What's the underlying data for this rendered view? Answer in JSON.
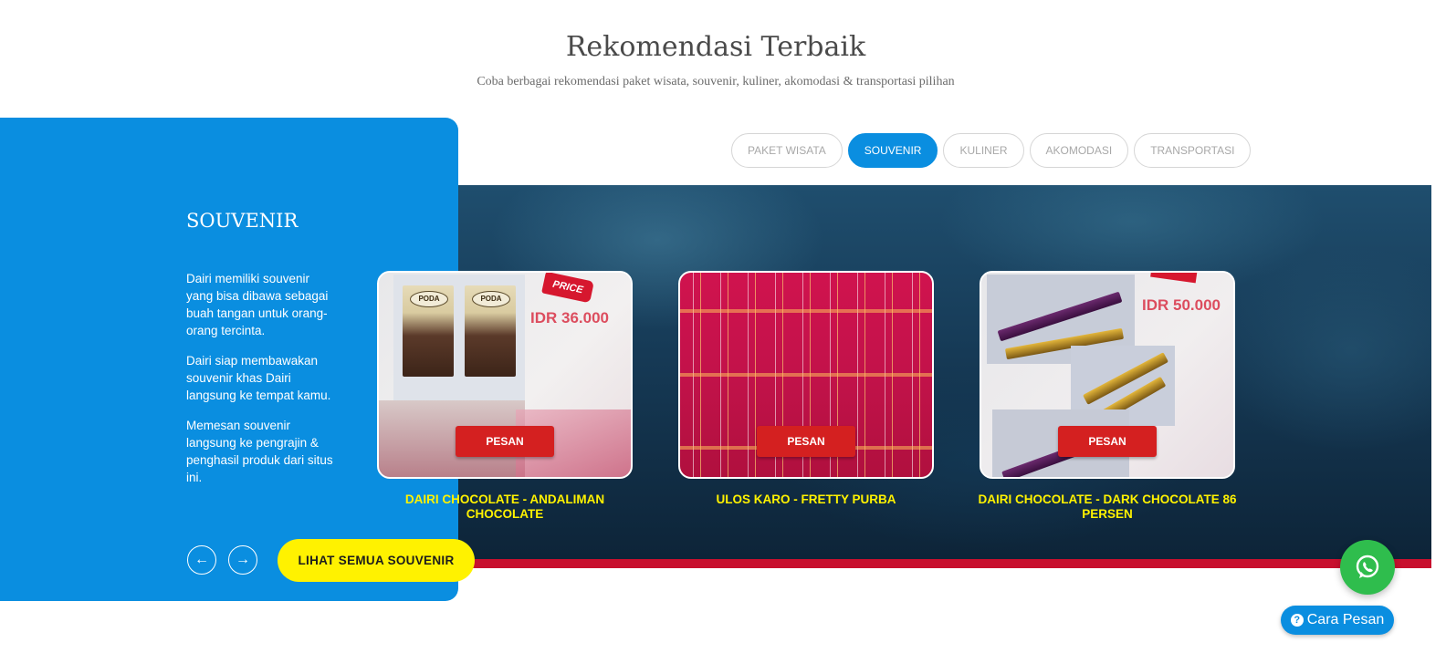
{
  "header": {
    "title": "Rekomendasi Terbaik",
    "subtitle": "Coba berbagai rekomendasi paket wisata, souvenir, kuliner, akomodasi & transportasi pilihan"
  },
  "tabs": [
    {
      "label": "PAKET WISATA",
      "active": false
    },
    {
      "label": "SOUVENIR",
      "active": true
    },
    {
      "label": "KULINER",
      "active": false
    },
    {
      "label": "AKOMODASI",
      "active": false
    },
    {
      "label": "TRANSPORTASI",
      "active": false
    }
  ],
  "side_panel": {
    "title": "SOUVENIR",
    "paragraphs": [
      "Dairi memiliki souvenir yang bisa dibawa sebagai buah tangan untuk orang-orang tercinta.",
      "Dairi siap membawakan souvenir khas Dairi langsung ke tempat kamu.",
      "Memesan souvenir langsung ke pengrajin & penghasil produk dari situs ini."
    ],
    "prev_icon": "arrow-left-icon",
    "next_icon": "arrow-right-icon",
    "see_all_label": "LIHAT SEMUA SOUVENIR"
  },
  "products": [
    {
      "name": "DAIRI CHOCOLATE - ANDALIMAN CHOCOLATE",
      "order_label": "PESAN",
      "image_text": {
        "brand": "PODA",
        "tag": "PRICE",
        "price": "IDR 36.000"
      }
    },
    {
      "name": "ULOS KARO - FRETTY PURBA",
      "order_label": "PESAN"
    },
    {
      "name": "DAIRI CHOCOLATE - DARK CHOCOLATE 86 PERSEN",
      "order_label": "PESAN",
      "image_text": {
        "price": "IDR 50.000"
      }
    }
  ],
  "floating": {
    "whatsapp_icon": "whatsapp-icon",
    "how_to_order_label": "Cara Pesan",
    "help_icon": "question-circle-icon"
  },
  "colors": {
    "accent_blue": "#0a8ee0",
    "button_yellow": "#fff200",
    "order_red": "#d42020",
    "whatsapp_green": "#2fbd4d",
    "product_name_yellow": "#fff200"
  }
}
